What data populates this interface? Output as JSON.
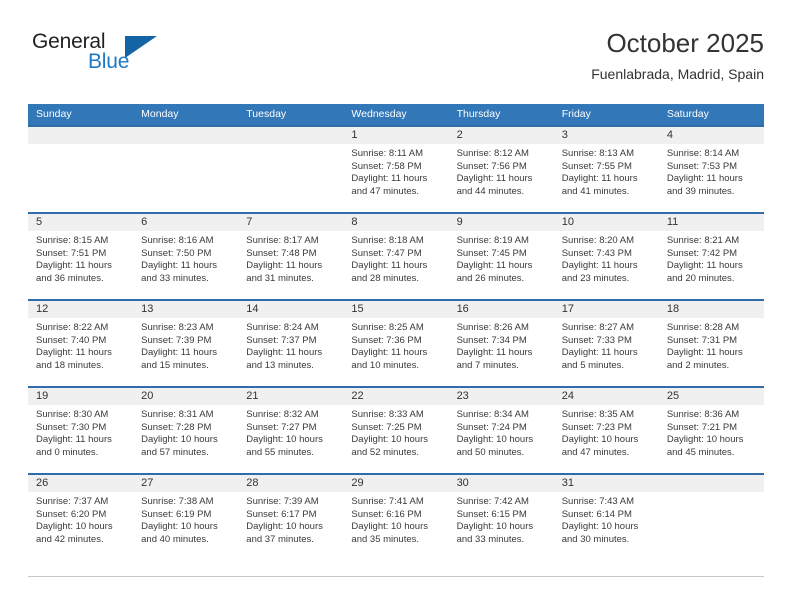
{
  "brand": {
    "name_top": "General",
    "name_bottom": "Blue",
    "logo_icon": "triangle-icon",
    "color_dark": "#231f20",
    "color_blue": "#1f7ac4",
    "color_triangle": "#1464a5"
  },
  "header": {
    "title": "October 2025",
    "subtitle": "Fuenlabrada, Madrid, Spain"
  },
  "theme": {
    "header_bar": "#3277b8",
    "row_divider": "#2f6ca8",
    "day_band": "#f0f0f0",
    "text": "#333333"
  },
  "weekdays": [
    "Sunday",
    "Monday",
    "Tuesday",
    "Wednesday",
    "Thursday",
    "Friday",
    "Saturday"
  ],
  "weeks": [
    [
      {
        "day": "",
        "sunrise": "",
        "sunset": "",
        "daylight_1": "",
        "daylight_2": ""
      },
      {
        "day": "",
        "sunrise": "",
        "sunset": "",
        "daylight_1": "",
        "daylight_2": ""
      },
      {
        "day": "",
        "sunrise": "",
        "sunset": "",
        "daylight_1": "",
        "daylight_2": ""
      },
      {
        "day": "1",
        "sunrise": "Sunrise: 8:11 AM",
        "sunset": "Sunset: 7:58 PM",
        "daylight_1": "Daylight: 11 hours",
        "daylight_2": "and 47 minutes."
      },
      {
        "day": "2",
        "sunrise": "Sunrise: 8:12 AM",
        "sunset": "Sunset: 7:56 PM",
        "daylight_1": "Daylight: 11 hours",
        "daylight_2": "and 44 minutes."
      },
      {
        "day": "3",
        "sunrise": "Sunrise: 8:13 AM",
        "sunset": "Sunset: 7:55 PM",
        "daylight_1": "Daylight: 11 hours",
        "daylight_2": "and 41 minutes."
      },
      {
        "day": "4",
        "sunrise": "Sunrise: 8:14 AM",
        "sunset": "Sunset: 7:53 PM",
        "daylight_1": "Daylight: 11 hours",
        "daylight_2": "and 39 minutes."
      }
    ],
    [
      {
        "day": "5",
        "sunrise": "Sunrise: 8:15 AM",
        "sunset": "Sunset: 7:51 PM",
        "daylight_1": "Daylight: 11 hours",
        "daylight_2": "and 36 minutes."
      },
      {
        "day": "6",
        "sunrise": "Sunrise: 8:16 AM",
        "sunset": "Sunset: 7:50 PM",
        "daylight_1": "Daylight: 11 hours",
        "daylight_2": "and 33 minutes."
      },
      {
        "day": "7",
        "sunrise": "Sunrise: 8:17 AM",
        "sunset": "Sunset: 7:48 PM",
        "daylight_1": "Daylight: 11 hours",
        "daylight_2": "and 31 minutes."
      },
      {
        "day": "8",
        "sunrise": "Sunrise: 8:18 AM",
        "sunset": "Sunset: 7:47 PM",
        "daylight_1": "Daylight: 11 hours",
        "daylight_2": "and 28 minutes."
      },
      {
        "day": "9",
        "sunrise": "Sunrise: 8:19 AM",
        "sunset": "Sunset: 7:45 PM",
        "daylight_1": "Daylight: 11 hours",
        "daylight_2": "and 26 minutes."
      },
      {
        "day": "10",
        "sunrise": "Sunrise: 8:20 AM",
        "sunset": "Sunset: 7:43 PM",
        "daylight_1": "Daylight: 11 hours",
        "daylight_2": "and 23 minutes."
      },
      {
        "day": "11",
        "sunrise": "Sunrise: 8:21 AM",
        "sunset": "Sunset: 7:42 PM",
        "daylight_1": "Daylight: 11 hours",
        "daylight_2": "and 20 minutes."
      }
    ],
    [
      {
        "day": "12",
        "sunrise": "Sunrise: 8:22 AM",
        "sunset": "Sunset: 7:40 PM",
        "daylight_1": "Daylight: 11 hours",
        "daylight_2": "and 18 minutes."
      },
      {
        "day": "13",
        "sunrise": "Sunrise: 8:23 AM",
        "sunset": "Sunset: 7:39 PM",
        "daylight_1": "Daylight: 11 hours",
        "daylight_2": "and 15 minutes."
      },
      {
        "day": "14",
        "sunrise": "Sunrise: 8:24 AM",
        "sunset": "Sunset: 7:37 PM",
        "daylight_1": "Daylight: 11 hours",
        "daylight_2": "and 13 minutes."
      },
      {
        "day": "15",
        "sunrise": "Sunrise: 8:25 AM",
        "sunset": "Sunset: 7:36 PM",
        "daylight_1": "Daylight: 11 hours",
        "daylight_2": "and 10 minutes."
      },
      {
        "day": "16",
        "sunrise": "Sunrise: 8:26 AM",
        "sunset": "Sunset: 7:34 PM",
        "daylight_1": "Daylight: 11 hours",
        "daylight_2": "and 7 minutes."
      },
      {
        "day": "17",
        "sunrise": "Sunrise: 8:27 AM",
        "sunset": "Sunset: 7:33 PM",
        "daylight_1": "Daylight: 11 hours",
        "daylight_2": "and 5 minutes."
      },
      {
        "day": "18",
        "sunrise": "Sunrise: 8:28 AM",
        "sunset": "Sunset: 7:31 PM",
        "daylight_1": "Daylight: 11 hours",
        "daylight_2": "and 2 minutes."
      }
    ],
    [
      {
        "day": "19",
        "sunrise": "Sunrise: 8:30 AM",
        "sunset": "Sunset: 7:30 PM",
        "daylight_1": "Daylight: 11 hours",
        "daylight_2": "and 0 minutes."
      },
      {
        "day": "20",
        "sunrise": "Sunrise: 8:31 AM",
        "sunset": "Sunset: 7:28 PM",
        "daylight_1": "Daylight: 10 hours",
        "daylight_2": "and 57 minutes."
      },
      {
        "day": "21",
        "sunrise": "Sunrise: 8:32 AM",
        "sunset": "Sunset: 7:27 PM",
        "daylight_1": "Daylight: 10 hours",
        "daylight_2": "and 55 minutes."
      },
      {
        "day": "22",
        "sunrise": "Sunrise: 8:33 AM",
        "sunset": "Sunset: 7:25 PM",
        "daylight_1": "Daylight: 10 hours",
        "daylight_2": "and 52 minutes."
      },
      {
        "day": "23",
        "sunrise": "Sunrise: 8:34 AM",
        "sunset": "Sunset: 7:24 PM",
        "daylight_1": "Daylight: 10 hours",
        "daylight_2": "and 50 minutes."
      },
      {
        "day": "24",
        "sunrise": "Sunrise: 8:35 AM",
        "sunset": "Sunset: 7:23 PM",
        "daylight_1": "Daylight: 10 hours",
        "daylight_2": "and 47 minutes."
      },
      {
        "day": "25",
        "sunrise": "Sunrise: 8:36 AM",
        "sunset": "Sunset: 7:21 PM",
        "daylight_1": "Daylight: 10 hours",
        "daylight_2": "and 45 minutes."
      }
    ],
    [
      {
        "day": "26",
        "sunrise": "Sunrise: 7:37 AM",
        "sunset": "Sunset: 6:20 PM",
        "daylight_1": "Daylight: 10 hours",
        "daylight_2": "and 42 minutes."
      },
      {
        "day": "27",
        "sunrise": "Sunrise: 7:38 AM",
        "sunset": "Sunset: 6:19 PM",
        "daylight_1": "Daylight: 10 hours",
        "daylight_2": "and 40 minutes."
      },
      {
        "day": "28",
        "sunrise": "Sunrise: 7:39 AM",
        "sunset": "Sunset: 6:17 PM",
        "daylight_1": "Daylight: 10 hours",
        "daylight_2": "and 37 minutes."
      },
      {
        "day": "29",
        "sunrise": "Sunrise: 7:41 AM",
        "sunset": "Sunset: 6:16 PM",
        "daylight_1": "Daylight: 10 hours",
        "daylight_2": "and 35 minutes."
      },
      {
        "day": "30",
        "sunrise": "Sunrise: 7:42 AM",
        "sunset": "Sunset: 6:15 PM",
        "daylight_1": "Daylight: 10 hours",
        "daylight_2": "and 33 minutes."
      },
      {
        "day": "31",
        "sunrise": "Sunrise: 7:43 AM",
        "sunset": "Sunset: 6:14 PM",
        "daylight_1": "Daylight: 10 hours",
        "daylight_2": "and 30 minutes."
      },
      {
        "day": "",
        "sunrise": "",
        "sunset": "",
        "daylight_1": "",
        "daylight_2": ""
      }
    ]
  ]
}
